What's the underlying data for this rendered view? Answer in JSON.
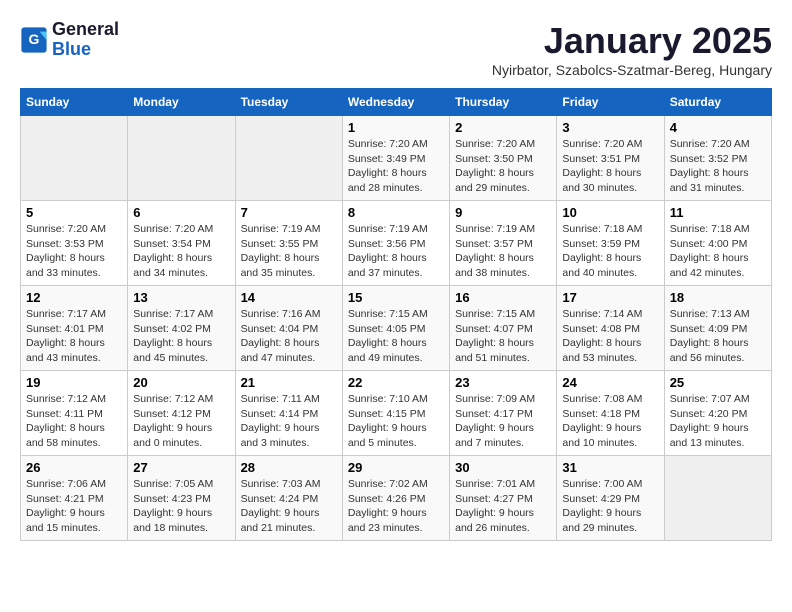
{
  "header": {
    "logo_general": "General",
    "logo_blue": "Blue",
    "month_title": "January 2025",
    "subtitle": "Nyirbator, Szabolcs-Szatmar-Bereg, Hungary"
  },
  "weekdays": [
    "Sunday",
    "Monday",
    "Tuesday",
    "Wednesday",
    "Thursday",
    "Friday",
    "Saturday"
  ],
  "weeks": [
    [
      {
        "day": "",
        "info": ""
      },
      {
        "day": "",
        "info": ""
      },
      {
        "day": "",
        "info": ""
      },
      {
        "day": "1",
        "info": "Sunrise: 7:20 AM\nSunset: 3:49 PM\nDaylight: 8 hours and 28 minutes."
      },
      {
        "day": "2",
        "info": "Sunrise: 7:20 AM\nSunset: 3:50 PM\nDaylight: 8 hours and 29 minutes."
      },
      {
        "day": "3",
        "info": "Sunrise: 7:20 AM\nSunset: 3:51 PM\nDaylight: 8 hours and 30 minutes."
      },
      {
        "day": "4",
        "info": "Sunrise: 7:20 AM\nSunset: 3:52 PM\nDaylight: 8 hours and 31 minutes."
      }
    ],
    [
      {
        "day": "5",
        "info": "Sunrise: 7:20 AM\nSunset: 3:53 PM\nDaylight: 8 hours and 33 minutes."
      },
      {
        "day": "6",
        "info": "Sunrise: 7:20 AM\nSunset: 3:54 PM\nDaylight: 8 hours and 34 minutes."
      },
      {
        "day": "7",
        "info": "Sunrise: 7:19 AM\nSunset: 3:55 PM\nDaylight: 8 hours and 35 minutes."
      },
      {
        "day": "8",
        "info": "Sunrise: 7:19 AM\nSunset: 3:56 PM\nDaylight: 8 hours and 37 minutes."
      },
      {
        "day": "9",
        "info": "Sunrise: 7:19 AM\nSunset: 3:57 PM\nDaylight: 8 hours and 38 minutes."
      },
      {
        "day": "10",
        "info": "Sunrise: 7:18 AM\nSunset: 3:59 PM\nDaylight: 8 hours and 40 minutes."
      },
      {
        "day": "11",
        "info": "Sunrise: 7:18 AM\nSunset: 4:00 PM\nDaylight: 8 hours and 42 minutes."
      }
    ],
    [
      {
        "day": "12",
        "info": "Sunrise: 7:17 AM\nSunset: 4:01 PM\nDaylight: 8 hours and 43 minutes."
      },
      {
        "day": "13",
        "info": "Sunrise: 7:17 AM\nSunset: 4:02 PM\nDaylight: 8 hours and 45 minutes."
      },
      {
        "day": "14",
        "info": "Sunrise: 7:16 AM\nSunset: 4:04 PM\nDaylight: 8 hours and 47 minutes."
      },
      {
        "day": "15",
        "info": "Sunrise: 7:15 AM\nSunset: 4:05 PM\nDaylight: 8 hours and 49 minutes."
      },
      {
        "day": "16",
        "info": "Sunrise: 7:15 AM\nSunset: 4:07 PM\nDaylight: 8 hours and 51 minutes."
      },
      {
        "day": "17",
        "info": "Sunrise: 7:14 AM\nSunset: 4:08 PM\nDaylight: 8 hours and 53 minutes."
      },
      {
        "day": "18",
        "info": "Sunrise: 7:13 AM\nSunset: 4:09 PM\nDaylight: 8 hours and 56 minutes."
      }
    ],
    [
      {
        "day": "19",
        "info": "Sunrise: 7:12 AM\nSunset: 4:11 PM\nDaylight: 8 hours and 58 minutes."
      },
      {
        "day": "20",
        "info": "Sunrise: 7:12 AM\nSunset: 4:12 PM\nDaylight: 9 hours and 0 minutes."
      },
      {
        "day": "21",
        "info": "Sunrise: 7:11 AM\nSunset: 4:14 PM\nDaylight: 9 hours and 3 minutes."
      },
      {
        "day": "22",
        "info": "Sunrise: 7:10 AM\nSunset: 4:15 PM\nDaylight: 9 hours and 5 minutes."
      },
      {
        "day": "23",
        "info": "Sunrise: 7:09 AM\nSunset: 4:17 PM\nDaylight: 9 hours and 7 minutes."
      },
      {
        "day": "24",
        "info": "Sunrise: 7:08 AM\nSunset: 4:18 PM\nDaylight: 9 hours and 10 minutes."
      },
      {
        "day": "25",
        "info": "Sunrise: 7:07 AM\nSunset: 4:20 PM\nDaylight: 9 hours and 13 minutes."
      }
    ],
    [
      {
        "day": "26",
        "info": "Sunrise: 7:06 AM\nSunset: 4:21 PM\nDaylight: 9 hours and 15 minutes."
      },
      {
        "day": "27",
        "info": "Sunrise: 7:05 AM\nSunset: 4:23 PM\nDaylight: 9 hours and 18 minutes."
      },
      {
        "day": "28",
        "info": "Sunrise: 7:03 AM\nSunset: 4:24 PM\nDaylight: 9 hours and 21 minutes."
      },
      {
        "day": "29",
        "info": "Sunrise: 7:02 AM\nSunset: 4:26 PM\nDaylight: 9 hours and 23 minutes."
      },
      {
        "day": "30",
        "info": "Sunrise: 7:01 AM\nSunset: 4:27 PM\nDaylight: 9 hours and 26 minutes."
      },
      {
        "day": "31",
        "info": "Sunrise: 7:00 AM\nSunset: 4:29 PM\nDaylight: 9 hours and 29 minutes."
      },
      {
        "day": "",
        "info": ""
      }
    ]
  ]
}
